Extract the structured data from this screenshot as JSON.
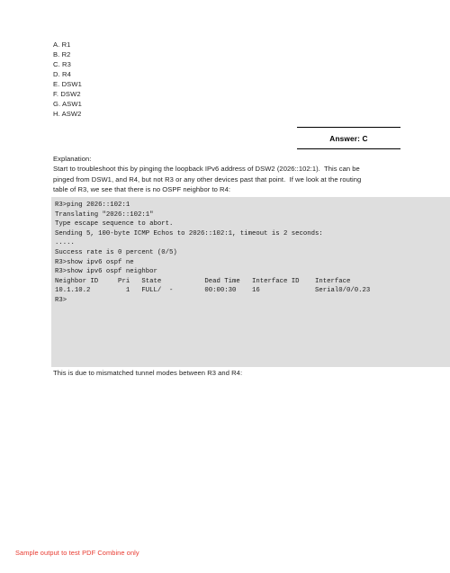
{
  "choices": {
    "items": [
      "A. R1",
      "B. R2",
      "C. R3",
      "D. R4",
      "E. DSW1",
      "F. DSW2",
      "G. ASW1",
      "H. ASW2"
    ]
  },
  "answer": {
    "label": "Answer: C"
  },
  "explanation": {
    "lines": [
      "Explanation:",
      "Start to troubleshoot this by pinging the loopback IPv6 address of DSW2 (2026::102:1).  This can be",
      "pinged from DSW1, and R4, but not R3 or any other devices past that point.  If we look at the routing",
      "table of R3, we see that there is no OSPF neighbor to R4:"
    ]
  },
  "console": {
    "background_color": "#dedede",
    "lines": [
      "R3>ping 2026::102:1",
      "",
      "Translating \"2026::102:1\"",
      "",
      "Type escape sequence to abort.",
      "Sending 5, 100-byte ICMP Echos to 2026::102:1, timeout is 2 seconds:",
      ".....",
      "Success rate is 0 percent (0/5)",
      "R3>show ipv6 ospf ne",
      "R3>show ipv6 ospf neighbor",
      "",
      "Neighbor ID     Pri   State           Dead Time   Interface ID    Interface",
      "10.1.10.2         1   FULL/  -        00:00:30    16              Serial0/0/0.23",
      "",
      "R3>"
    ]
  },
  "closing": {
    "lines": [
      "This is due to mismatched tunnel modes between R3 and R4:"
    ]
  },
  "footer": {
    "watermark": "Sample output to test PDF Combine only",
    "color": "#e8392f"
  }
}
